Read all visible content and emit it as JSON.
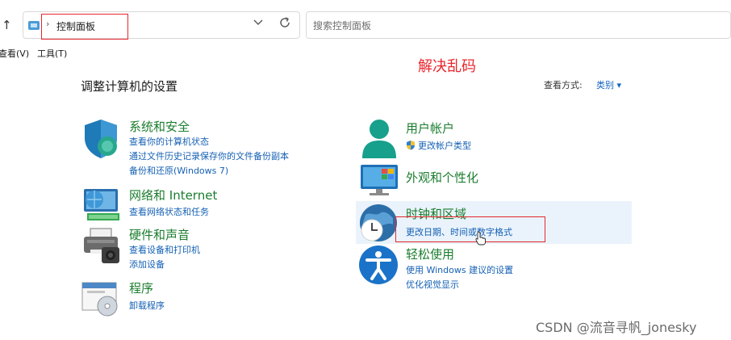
{
  "address_bar": {
    "up_arrow": "↑",
    "separator": "›",
    "path": "控制面板",
    "dropdown_icon": "chevron-down-icon",
    "refresh_icon": "refresh-icon"
  },
  "search": {
    "placeholder": "搜索控制面板"
  },
  "menu": {
    "items": [
      "查看(V)",
      "工具(T)"
    ]
  },
  "annotation": "解决乱码",
  "main": {
    "title": "调整计算机的设置",
    "view_by_label": "查看方式:",
    "view_by_value": "类别 ▾"
  },
  "categories": {
    "system_security": {
      "title": "系统和安全",
      "links": [
        "查看你的计算机状态",
        "通过文件历史记录保存你的文件备份副本",
        "备份和还原(Windows 7)"
      ],
      "icon": "shield-icon"
    },
    "network": {
      "title": "网络和 Internet",
      "links": [
        "查看网络状态和任务"
      ],
      "icon": "network-globe-icon"
    },
    "hardware_sound": {
      "title": "硬件和声音",
      "links": [
        "查看设备和打印机",
        "添加设备"
      ],
      "icon": "printer-icon"
    },
    "programs": {
      "title": "程序",
      "links": [
        "卸载程序"
      ],
      "icon": "programs-disc-icon"
    },
    "user_accounts": {
      "title": "用户帐户",
      "links": [
        "更改帐户类型"
      ],
      "icon": "user-icon"
    },
    "appearance": {
      "title": "外观和个性化",
      "links": [],
      "icon": "monitor-icon"
    },
    "clock_region": {
      "title": "时钟和区域",
      "links": [
        "更改日期、时间或数字格式"
      ],
      "icon": "clock-globe-icon"
    },
    "ease_access": {
      "title": "轻松使用",
      "links": [
        "使用 Windows 建议的设置",
        "优化视觉显示"
      ],
      "icon": "accessibility-icon"
    }
  },
  "watermark": "CSDN @流音寻帆_jonesky",
  "colors": {
    "category_title": "#1b7d2e",
    "link": "#1460b4",
    "annotation_red": "#e8262d",
    "highlight": "#eaf3fb"
  }
}
